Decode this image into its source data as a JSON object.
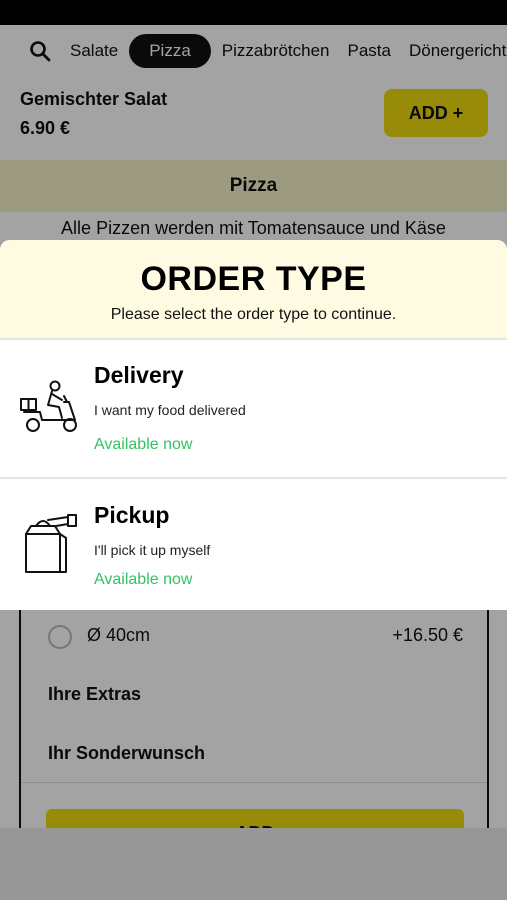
{
  "categories": {
    "items": [
      {
        "label": "Salate",
        "active": false
      },
      {
        "label": "Pizza",
        "active": true
      },
      {
        "label": "Pizzabrötchen",
        "active": false
      },
      {
        "label": "Pasta",
        "active": false
      },
      {
        "label": "Dönergericht",
        "active": false
      }
    ]
  },
  "product": {
    "name": "Gemischter Salat",
    "price": "6.90 €",
    "add_label": "ADD +"
  },
  "section": {
    "title": "Pizza",
    "description": "Alle Pizzen werden mit Tomatensauce und Käse"
  },
  "card": {
    "size_label": "Ø 40cm",
    "size_price": "+16.50 €",
    "extras_label": "Ihre Extras",
    "wish_label": "Ihr Sonderwunsch",
    "add_label": "ADD"
  },
  "modal": {
    "title": "ORDER TYPE",
    "subtitle": "Please select the order type to continue.",
    "options": [
      {
        "title": "Delivery",
        "description": "I want my food delivered",
        "status": "Available now",
        "icon": "scooter-delivery-icon"
      },
      {
        "title": "Pickup",
        "description": "I'll pick it up myself",
        "status": "Available now",
        "icon": "pickup-bag-icon"
      }
    ]
  },
  "colors": {
    "accent": "#ecd90e",
    "available": "#34c263",
    "modal_header": "#fffbe3",
    "section_header": "#f5f1c9"
  }
}
